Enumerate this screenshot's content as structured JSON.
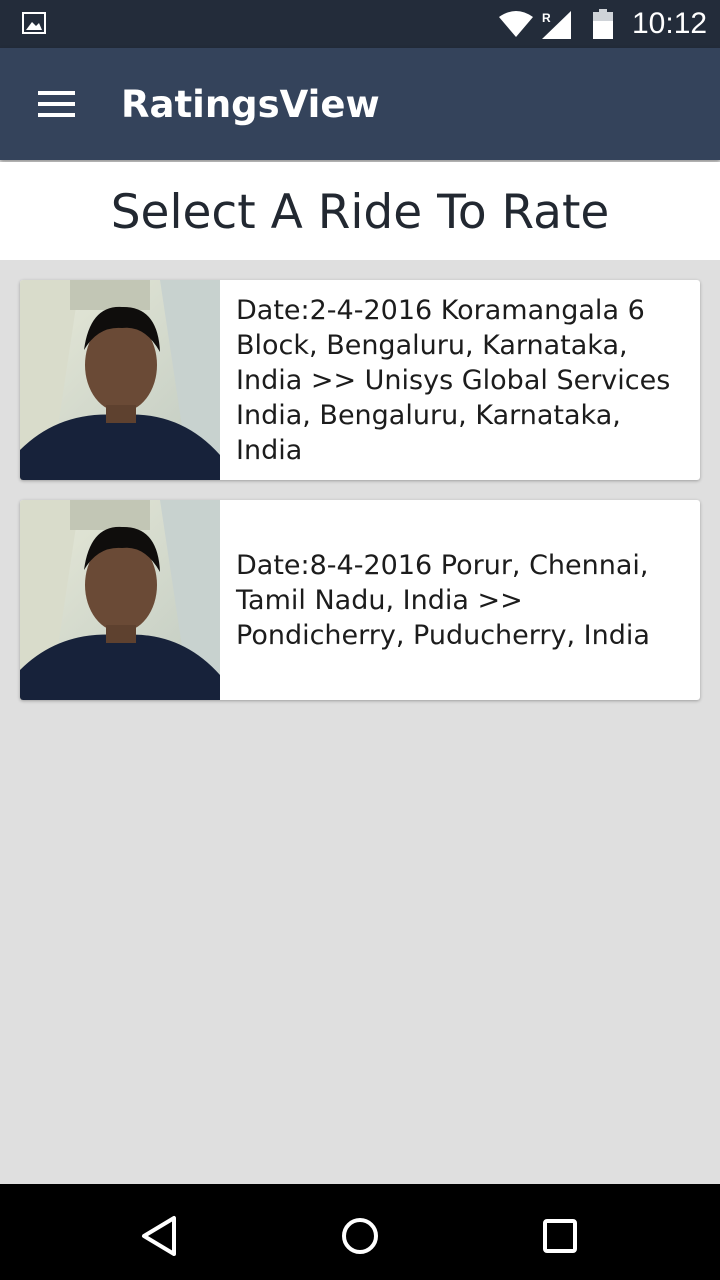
{
  "status_bar": {
    "time": "10:12",
    "icons": [
      "gallery-icon",
      "wifi-icon",
      "signal-icon",
      "battery-icon"
    ]
  },
  "toolbar": {
    "title": "RatingsView",
    "menu_icon": "hamburger-menu-icon"
  },
  "heading": "Select A Ride To Rate",
  "rides": [
    {
      "description": "Date:2-4-2016 Koramangala 6 Block, Bengaluru, Karnataka, India >> Unisys Global Services India, Bengaluru, Karnataka, India"
    },
    {
      "description": "Date:8-4-2016 Porur, Chennai, Tamil Nadu, India >> Pondicherry, Puducherry, India"
    }
  ],
  "nav_bar": {
    "icons": [
      "back-icon",
      "home-icon",
      "recents-icon"
    ]
  },
  "colors": {
    "status_bar": "#232c3a",
    "toolbar": "#34435b",
    "background": "#dfdfdf"
  }
}
